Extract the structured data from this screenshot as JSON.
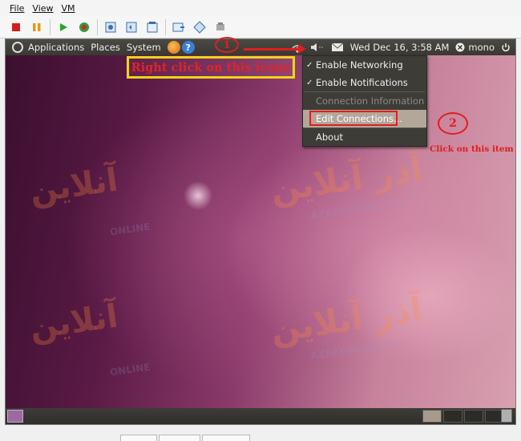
{
  "host": {
    "menu": [
      "File",
      "View",
      "VM"
    ]
  },
  "panel": {
    "menus": [
      "Applications",
      "Places",
      "System"
    ],
    "datetime": "Wed Dec 16,  3:58 AM",
    "user": "mono"
  },
  "network_menu": {
    "items": [
      {
        "label": "Enable Networking",
        "checked": true
      },
      {
        "label": "Enable Notifications",
        "checked": true
      },
      {
        "label": "Connection Information",
        "disabled": true
      },
      {
        "label": "Edit Connections...",
        "highlighted": true
      },
      {
        "label": "About"
      }
    ]
  },
  "annotations": {
    "step1_number": "1",
    "step1_text": "Right click on this icone",
    "step2_number": "2",
    "step2_text": "Click on this item"
  },
  "watermark": {
    "persian": "آنلاین",
    "persian2": "آذر آنلاین",
    "online": "ONLINE",
    "azar": "AZARONLINE.com"
  },
  "colors": {
    "annotation_red": "#e01e1e",
    "annotation_yellow": "#f2d21a",
    "panel_bg": "#3e3c37",
    "menu_highlight": "#b3a79a"
  }
}
